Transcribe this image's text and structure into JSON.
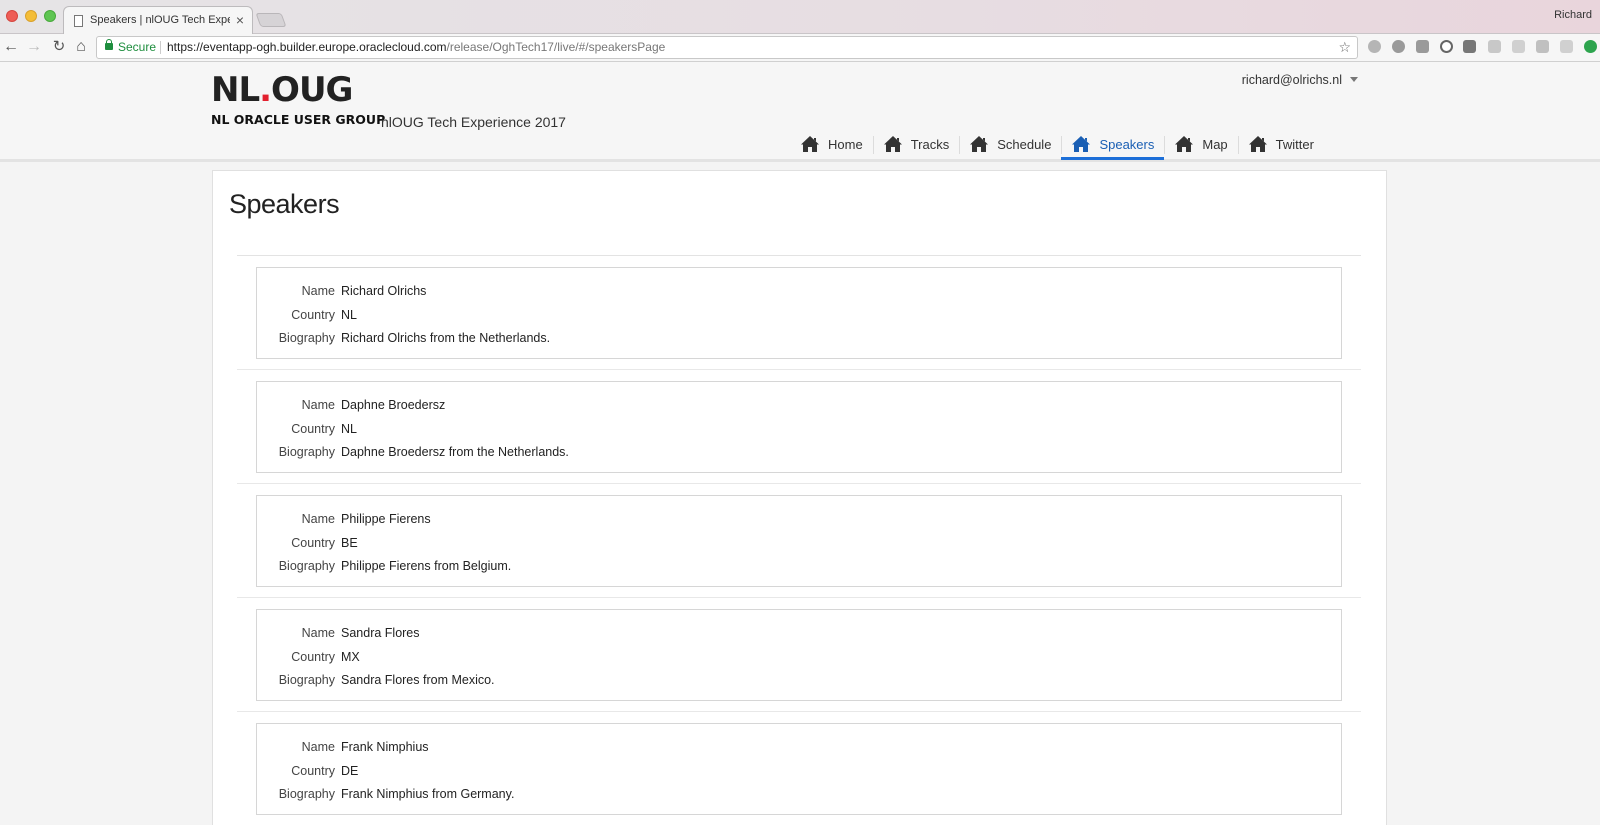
{
  "browser": {
    "tab_title": "Speakers | nlOUG Tech Experience 2017",
    "profile_name": "Richard",
    "secure_label": "Secure",
    "url_host": "https://eventapp-ogh.builder.europe.oraclecloud.com",
    "url_path": "/release/OghTech17/live/#/speakersPage"
  },
  "header": {
    "logo_text_nl": "NL",
    "logo_text_oug": "OUG",
    "logo_subtitle": "NL ORACLE USER GROUP",
    "app_title": "nlOUG Tech Experience 2017",
    "user_email": "richard@olrichs.nl",
    "nav": [
      {
        "label": "Home",
        "active": false
      },
      {
        "label": "Tracks",
        "active": false
      },
      {
        "label": "Schedule",
        "active": false
      },
      {
        "label": "Speakers",
        "active": true
      },
      {
        "label": "Map",
        "active": false
      },
      {
        "label": "Twitter",
        "active": false
      }
    ]
  },
  "page": {
    "title": "Speakers",
    "labels": {
      "name": "Name",
      "country": "Country",
      "biography": "Biography"
    },
    "speakers": [
      {
        "name": "Richard Olrichs",
        "country": "NL",
        "biography": "Richard Olrichs from the Netherlands."
      },
      {
        "name": "Daphne Broedersz",
        "country": "NL",
        "biography": "Daphne Broedersz from the Netherlands."
      },
      {
        "name": "Philippe Fierens",
        "country": "BE",
        "biography": "Philippe Fierens from Belgium."
      },
      {
        "name": "Sandra Flores",
        "country": "MX",
        "biography": "Sandra Flores from Mexico."
      },
      {
        "name": "Frank Nimphius",
        "country": "DE",
        "biography": "Frank Nimphius from Germany."
      }
    ]
  },
  "colors": {
    "accent": "#1d6fd8",
    "brand_red": "#e2202e",
    "secure_green": "#1e8e3e"
  }
}
